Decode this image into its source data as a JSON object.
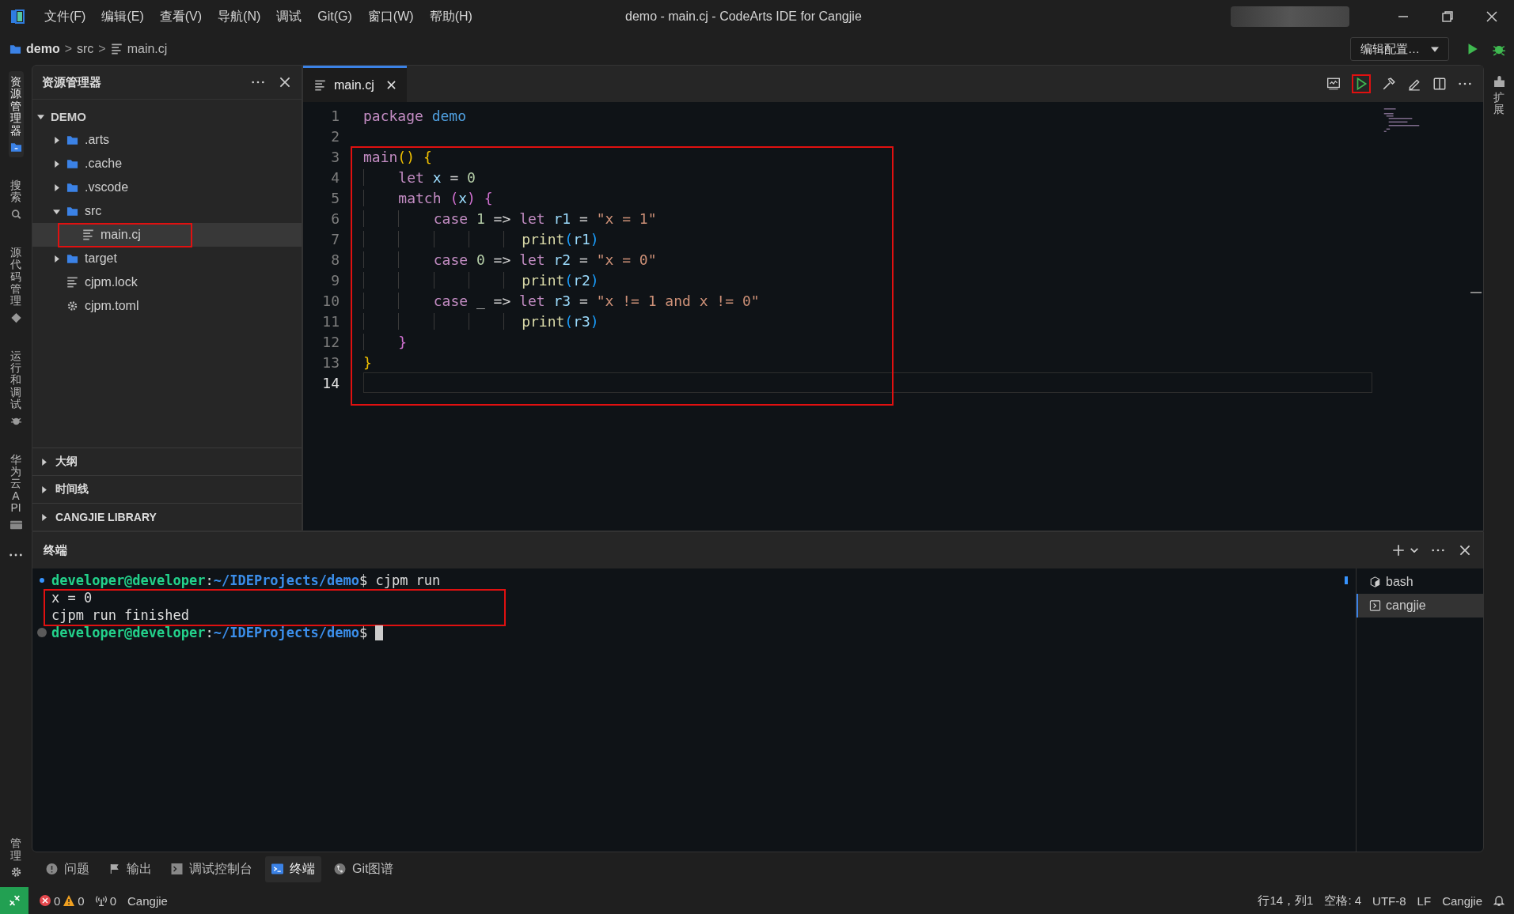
{
  "titlebar": {
    "menu": [
      "文件(F)",
      "编辑(E)",
      "查看(V)",
      "导航(N)",
      "调试",
      "Git(G)",
      "窗口(W)",
      "帮助(H)"
    ],
    "title": "demo - main.cj - CodeArts IDE for Cangjie"
  },
  "breadcrumb": [
    {
      "label": "demo",
      "kind": "folder"
    },
    {
      "label": ">",
      "kind": "sep"
    },
    {
      "label": "src",
      "kind": "plain"
    },
    {
      "label": ">",
      "kind": "sep"
    },
    {
      "label": "main.cj",
      "kind": "file"
    }
  ],
  "run_config": {
    "label": "编辑配置…"
  },
  "activity_bar": [
    {
      "label": "资源管理器",
      "kind": "files",
      "selected": true
    },
    {
      "label": "搜索",
      "kind": "search",
      "selected": false
    },
    {
      "label": "源代码管理",
      "kind": "git",
      "selected": false
    },
    {
      "label": "运行和调试",
      "kind": "debug",
      "selected": false
    },
    {
      "label": "华为云 API",
      "kind": "api",
      "selected": false
    }
  ],
  "manage": {
    "label": "管理"
  },
  "explorer": {
    "title": "资源管理器",
    "root": {
      "label": "DEMO",
      "expanded": true,
      "children": [
        {
          "label": ".arts",
          "kind": "folder",
          "expanded": false,
          "selected": false,
          "boxed": false
        },
        {
          "label": ".cache",
          "kind": "folder",
          "expanded": false,
          "selected": false,
          "boxed": false
        },
        {
          "label": ".vscode",
          "kind": "folder",
          "expanded": false,
          "selected": false,
          "boxed": false
        },
        {
          "label": "src",
          "kind": "folder",
          "expanded": true,
          "selected": false,
          "boxed": false,
          "children": [
            {
              "label": "main.cj",
              "kind": "file",
              "selected": true,
              "boxed": true
            }
          ]
        },
        {
          "label": "target",
          "kind": "folder",
          "expanded": false,
          "selected": false,
          "boxed": false
        },
        {
          "label": "cjpm.lock",
          "kind": "file",
          "selected": false,
          "boxed": false
        },
        {
          "label": "cjpm.toml",
          "kind": "config",
          "selected": false,
          "boxed": false
        }
      ]
    },
    "sections": [
      {
        "label": "大纲",
        "expanded": false
      },
      {
        "label": "时间线",
        "expanded": false
      },
      {
        "label": "CANGJIE LIBRARY",
        "expanded": false
      }
    ]
  },
  "editor": {
    "tabs": [
      {
        "label": "main.cj",
        "selected": true
      }
    ],
    "run_button": {
      "boxed": true
    },
    "blocks": [
      {
        "boxed": false,
        "lines": [
          {
            "number": "1",
            "current": false,
            "tokens": [
              {
                "text": "package",
                "kind": "kw"
              },
              {
                "text": " demo",
                "kind": "ns"
              }
            ]
          },
          {
            "number": "2",
            "current": false
          }
        ]
      },
      {
        "boxed": true,
        "lines": [
          {
            "number": "3",
            "current": false,
            "tokens": [
              {
                "text": "main",
                "kind": "kw"
              },
              {
                "text": "()",
                "kind": "b1"
              },
              {
                "text": " {",
                "kind": "b1"
              }
            ]
          },
          {
            "number": "4",
            "current": false,
            "tokens": [
              {
                "text": "    let",
                "kind": "kw"
              },
              {
                "text": " x",
                "kind": "var"
              },
              {
                "text": " = ",
                "kind": "plain"
              },
              {
                "text": "0",
                "kind": "num"
              }
            ]
          },
          {
            "number": "5",
            "current": false,
            "tokens": [
              {
                "text": "    match",
                "kind": "kw"
              },
              {
                "text": " (",
                "kind": "b2"
              },
              {
                "text": "x",
                "kind": "var"
              },
              {
                "text": ")",
                "kind": "b2"
              },
              {
                "text": " {",
                "kind": "b2"
              }
            ]
          },
          {
            "number": "6",
            "current": false,
            "tokens": [
              {
                "text": "        case",
                "kind": "kw"
              },
              {
                "text": " 1",
                "kind": "num"
              },
              {
                "text": " => ",
                "kind": "plain"
              },
              {
                "text": "let",
                "kind": "kw"
              },
              {
                "text": " r1",
                "kind": "var"
              },
              {
                "text": " = ",
                "kind": "plain"
              },
              {
                "text": "\"x = 1\"",
                "kind": "str"
              }
            ]
          },
          {
            "number": "7",
            "current": false,
            "tokens": [
              {
                "text": "                  print",
                "kind": "fn"
              },
              {
                "text": "(",
                "kind": "b3"
              },
              {
                "text": "r1",
                "kind": "var"
              },
              {
                "text": ")",
                "kind": "b3"
              }
            ]
          },
          {
            "number": "8",
            "current": false,
            "tokens": [
              {
                "text": "        case",
                "kind": "kw"
              },
              {
                "text": " 0",
                "kind": "num"
              },
              {
                "text": " => ",
                "kind": "plain"
              },
              {
                "text": "let",
                "kind": "kw"
              },
              {
                "text": " r2",
                "kind": "var"
              },
              {
                "text": " = ",
                "kind": "plain"
              },
              {
                "text": "\"x = 0\"",
                "kind": "str"
              }
            ]
          },
          {
            "number": "9",
            "current": false,
            "tokens": [
              {
                "text": "                  print",
                "kind": "fn"
              },
              {
                "text": "(",
                "kind": "b3"
              },
              {
                "text": "r2",
                "kind": "var"
              },
              {
                "text": ")",
                "kind": "b3"
              }
            ]
          },
          {
            "number": "10",
            "current": false,
            "tokens": [
              {
                "text": "        case",
                "kind": "kw"
              },
              {
                "text": " _ => ",
                "kind": "plain"
              },
              {
                "text": "let",
                "kind": "kw"
              },
              {
                "text": " r3",
                "kind": "var"
              },
              {
                "text": " = ",
                "kind": "plain"
              },
              {
                "text": "\"x != 1 and x != 0\"",
                "kind": "str"
              }
            ]
          },
          {
            "number": "11",
            "current": false,
            "tokens": [
              {
                "text": "                  print",
                "kind": "fn"
              },
              {
                "text": "(",
                "kind": "b3"
              },
              {
                "text": "r3",
                "kind": "var"
              },
              {
                "text": ")",
                "kind": "b3"
              }
            ]
          },
          {
            "number": "12",
            "current": false,
            "tokens": [
              {
                "text": "    }",
                "kind": "b2"
              }
            ]
          },
          {
            "number": "13",
            "current": false,
            "tokens": [
              {
                "text": "}",
                "kind": "b1"
              }
            ]
          },
          {
            "number": "14",
            "current": true
          }
        ]
      }
    ]
  },
  "right_bar": {
    "label": "扩展"
  },
  "terminal": {
    "title": "终端",
    "blocks": [
      {
        "boxed": false,
        "lines": [
          {
            "kind": "prompt",
            "succeeded": true,
            "user": "developer@developer",
            "sep": ":",
            "path": "~/IDEProjects/demo",
            "prompt": "$",
            "command": " cjpm run"
          }
        ]
      },
      {
        "boxed": true,
        "lines": [
          {
            "kind": "output",
            "text": "x = 0"
          },
          {
            "kind": "output",
            "text": "cjpm run finished"
          }
        ]
      },
      {
        "boxed": false,
        "lines": [
          {
            "kind": "prompt",
            "succeeded": false,
            "user": "developer@developer",
            "sep": ":",
            "path": "~/IDEProjects/demo",
            "prompt": "$",
            "cursor": true
          }
        ]
      }
    ],
    "sessions": [
      {
        "label": "bash",
        "kind": "shell",
        "selected": false
      },
      {
        "label": "cangjie",
        "kind": "task",
        "selected": true
      }
    ]
  },
  "panel_tabs": [
    {
      "label": "问题",
      "kind": "problems",
      "selected": false
    },
    {
      "label": "输出",
      "kind": "output",
      "selected": false
    },
    {
      "label": "调试控制台",
      "kind": "console",
      "selected": false
    },
    {
      "label": "终端",
      "kind": "terminal",
      "selected": true
    },
    {
      "label": "Git图谱",
      "kind": "graph",
      "selected": false
    }
  ],
  "status_bar": {
    "errors": "0",
    "warnings": "0",
    "ports": "0",
    "server": "Cangjie",
    "position": "行14，列1",
    "indent": "空格: 4",
    "encoding": "UTF-8",
    "eol": "LF",
    "language": "Cangjie"
  }
}
